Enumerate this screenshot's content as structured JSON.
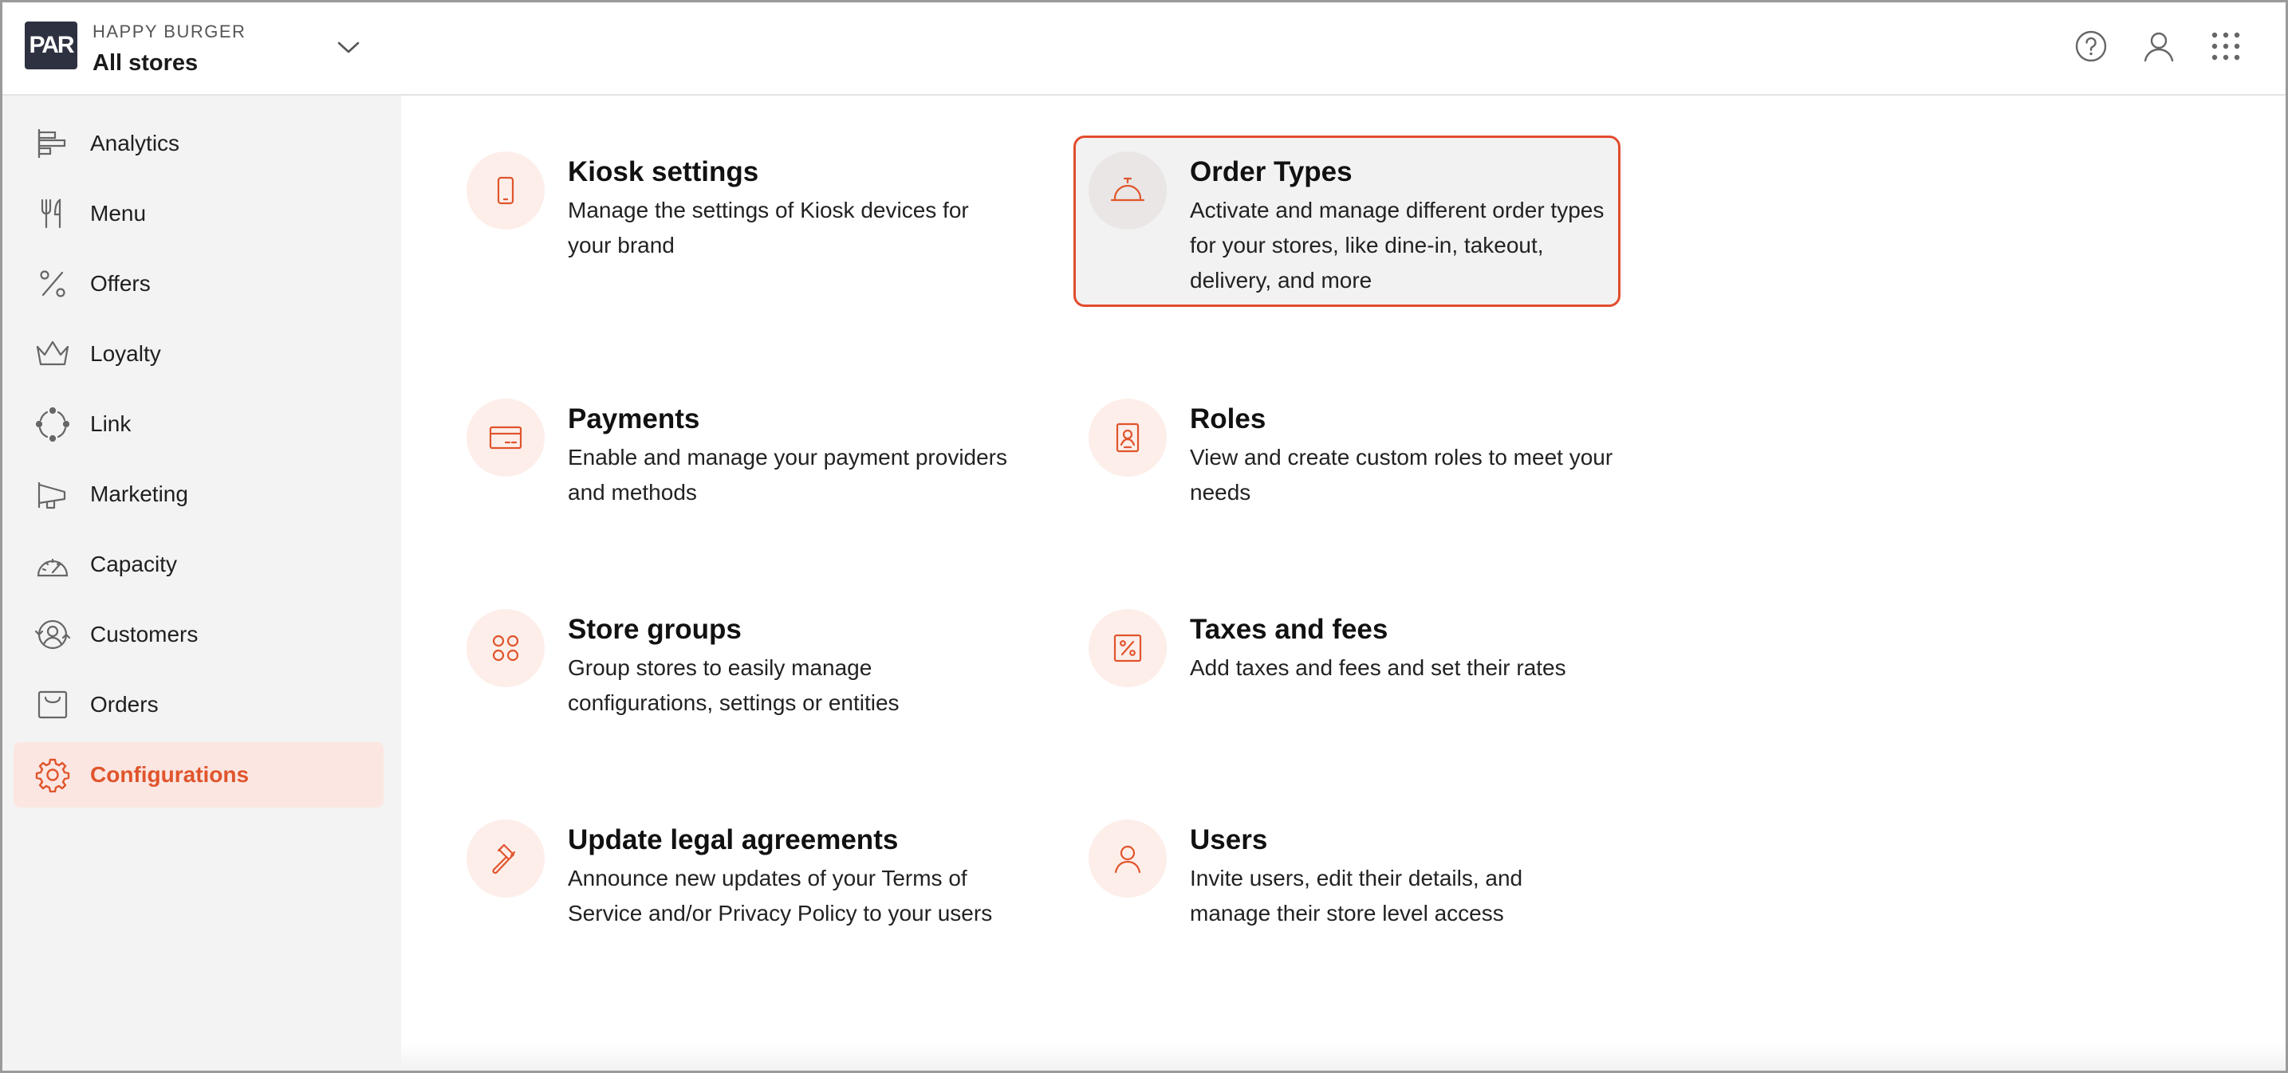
{
  "header": {
    "logo_text": "PAR",
    "brand_name": "HAPPY BURGER",
    "store_selector": "All stores"
  },
  "sidebar": {
    "items": [
      {
        "label": "Analytics",
        "icon": "analytics-icon"
      },
      {
        "label": "Menu",
        "icon": "fork-knife-icon"
      },
      {
        "label": "Offers",
        "icon": "percent-icon"
      },
      {
        "label": "Loyalty",
        "icon": "crown-icon"
      },
      {
        "label": "Link",
        "icon": "link-circle-icon"
      },
      {
        "label": "Marketing",
        "icon": "megaphone-icon"
      },
      {
        "label": "Capacity",
        "icon": "gauge-icon"
      },
      {
        "label": "Customers",
        "icon": "customers-icon"
      },
      {
        "label": "Orders",
        "icon": "orders-icon"
      },
      {
        "label": "Configurations",
        "icon": "gear-icon",
        "active": true
      }
    ]
  },
  "cards": [
    {
      "title": "Kiosk settings",
      "description": "Manage the settings of Kiosk devices for your brand",
      "icon": "tablet-icon"
    },
    {
      "title": "Order Types",
      "description": "Activate and manage different order types for your stores, like dine-in, takeout, delivery, and more",
      "icon": "service-bell-icon",
      "selected": true
    },
    {
      "title": "Payments",
      "description": "Enable and manage your payment providers and methods",
      "icon": "credit-card-icon"
    },
    {
      "title": "Roles",
      "description": "View and create custom roles to meet your needs",
      "icon": "id-badge-icon"
    },
    {
      "title": "Store groups",
      "description": "Group stores to easily manage configurations, settings or entities",
      "icon": "grid-circles-icon"
    },
    {
      "title": "Taxes and fees",
      "description": "Add taxes and fees and set their rates",
      "icon": "tax-percent-icon"
    },
    {
      "title": "Update legal agreements",
      "description": "Announce new updates of your Terms of Service and/or Privacy Policy to your users",
      "icon": "gavel-icon"
    },
    {
      "title": "Users",
      "description": "Invite users, edit their details, and manage their store level access",
      "icon": "user-icon"
    }
  ],
  "colors": {
    "accent": "#e0552c",
    "selected_border": "#e24c2f",
    "sidebar_bg": "#f3f3f3",
    "active_bg": "#fbe6e2",
    "icon_circle_bg": "#fdeeea",
    "logo_bg": "#2e3140"
  }
}
